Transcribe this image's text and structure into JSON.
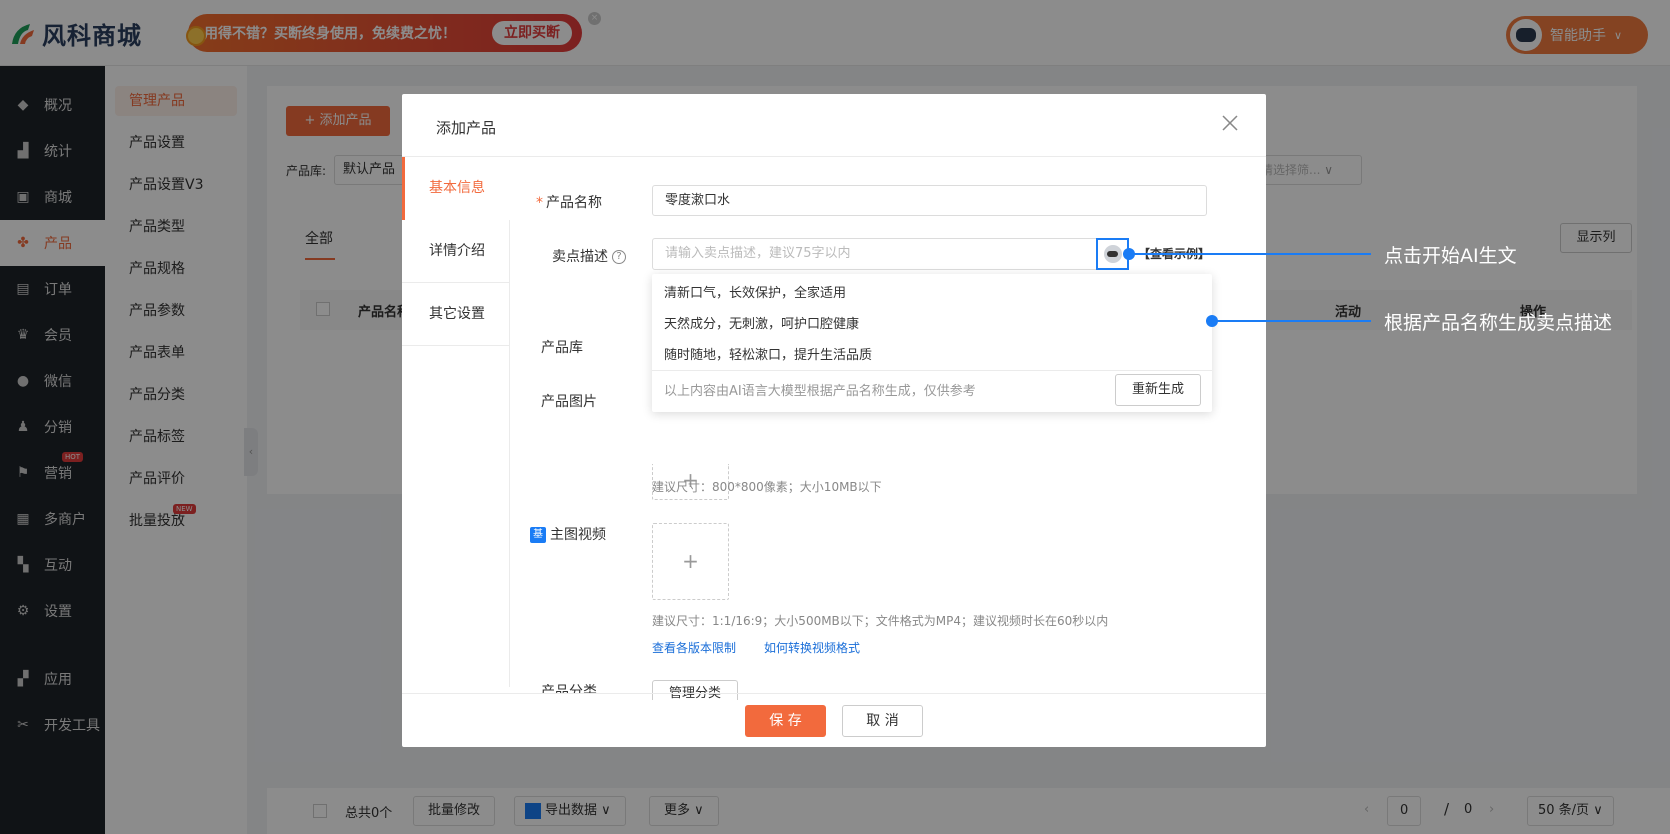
{
  "header": {
    "logo_text": "风科商城",
    "promo_text": "用得不错？买断终身使用，免续费之忧！",
    "promo_button": "立即买断",
    "promo_close": "×",
    "assistant_label": "智能助手"
  },
  "nav": {
    "items": [
      {
        "label": "概况",
        "icon": "graduation-cap-icon",
        "glyph": "◆"
      },
      {
        "label": "统计",
        "icon": "chart-icon",
        "glyph": "▟"
      },
      {
        "label": "商城",
        "icon": "store-icon",
        "glyph": "▣"
      },
      {
        "label": "产品",
        "icon": "grid-icon",
        "glyph": "✤"
      },
      {
        "label": "订单",
        "icon": "order-icon",
        "glyph": "▤"
      },
      {
        "label": "会员",
        "icon": "crown-icon",
        "glyph": "♛"
      },
      {
        "label": "微信",
        "icon": "wechat-icon",
        "glyph": "●"
      },
      {
        "label": "分销",
        "icon": "user-share-icon",
        "glyph": "♟"
      },
      {
        "label": "营销",
        "icon": "flag-icon",
        "glyph": "⚑",
        "badge": "HOT"
      },
      {
        "label": "多商户",
        "icon": "multi-store-icon",
        "glyph": "▦"
      },
      {
        "label": "互动",
        "icon": "interaction-icon",
        "glyph": "▚"
      },
      {
        "label": "设置",
        "icon": "gear-icon",
        "glyph": "⚙"
      },
      {
        "label": "应用",
        "icon": "apps-icon",
        "glyph": "▞"
      },
      {
        "label": "开发工具",
        "icon": "tools-icon",
        "glyph": "✂"
      }
    ]
  },
  "subnav": {
    "items": [
      {
        "label": "管理产品"
      },
      {
        "label": "产品设置"
      },
      {
        "label": "产品设置V3"
      },
      {
        "label": "产品类型"
      },
      {
        "label": "产品规格"
      },
      {
        "label": "产品参数"
      },
      {
        "label": "产品表单"
      },
      {
        "label": "产品分类"
      },
      {
        "label": "产品标签"
      },
      {
        "label": "产品评价"
      },
      {
        "label": "批量投放",
        "badge": "NEW"
      }
    ]
  },
  "main": {
    "add_button": "+ 添加产品",
    "lib_label": "产品库:",
    "lib_value": "默认产品",
    "filter_placeholder": "请选择筛...",
    "tab_all": "全部",
    "columns_button": "显示列",
    "col_name": "产品名称",
    "col_activity": "活动",
    "col_ops": "操作"
  },
  "footer": {
    "total": "总共0个",
    "batch_edit": "批量修改",
    "export": "导出数据",
    "more": "更多",
    "page_current": "0",
    "page_sep": "/",
    "page_total": "0",
    "page_size": "50 条/页"
  },
  "modal": {
    "title": "添加产品",
    "tabs": [
      "基本信息",
      "详情介绍",
      "其它设置"
    ],
    "name_label": "产品名称",
    "name_value": "零度漱口水",
    "desc_label": "卖点描述",
    "desc_placeholder": "请输入卖点描述，建议75字以内",
    "example_link": "【查看示例】",
    "suggestions": [
      "清新口气，长效保护，全家适用",
      "天然成分，无刺激，呵护口腔健康",
      "随时随地，轻松漱口，提升生活品质"
    ],
    "suggest_note": "以上内容由AI语言大模型根据产品名称生成，仅供参考",
    "regen_button": "重新生成",
    "lib_label": "产品库",
    "image_label": "产品图片",
    "image_hint": "建议尺寸：800*800像素；大小10MB以下",
    "video_label": "主图视频",
    "video_hint": "建议尺寸：1:1/16:9；大小500MB以下；文件格式为MP4；建议视频时长在60秒以内",
    "link_limits": "查看各版本限制",
    "link_convert": "如何转换视频格式",
    "category_label": "产品分类",
    "category_button": "管理分类",
    "save_button": "保 存",
    "cancel_button": "取 消",
    "upload_plus": "+"
  },
  "callouts": {
    "ai_start": "点击开始AI生文",
    "ai_generate": "根据产品名称生成卖点描述"
  }
}
